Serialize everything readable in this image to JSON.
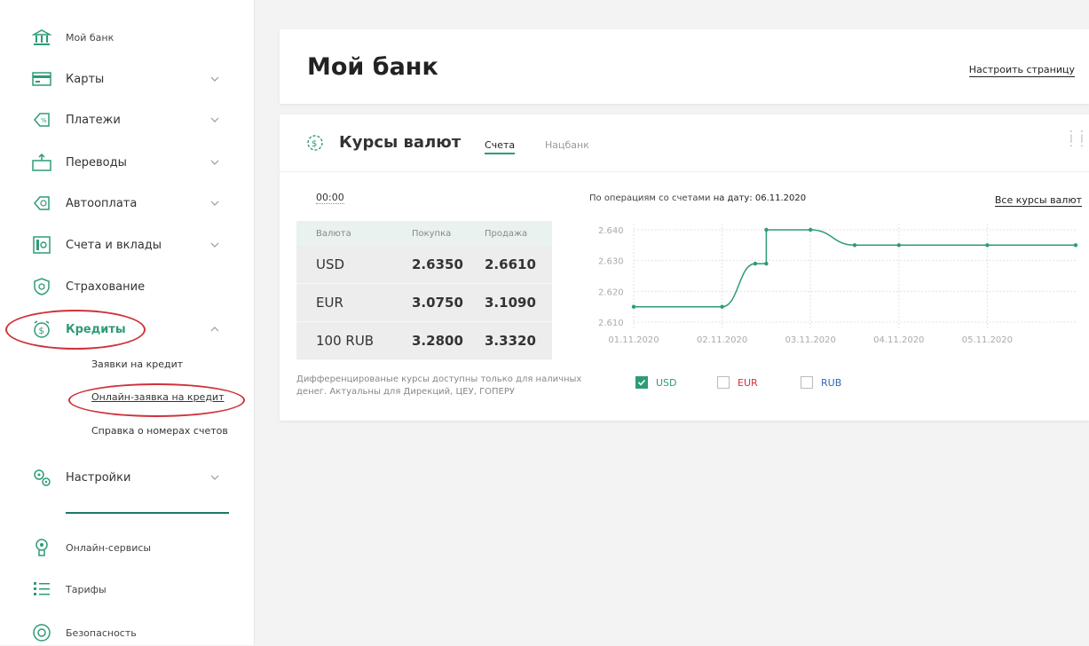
{
  "sidebar": {
    "items": [
      {
        "label": "Мой банк"
      },
      {
        "label": "Карты"
      },
      {
        "label": "Платежи"
      },
      {
        "label": "Переводы"
      },
      {
        "label": "Автооплата"
      },
      {
        "label": "Счета и вклады"
      },
      {
        "label": "Страхование"
      },
      {
        "label": "Кредиты"
      },
      {
        "label": "Настройки"
      }
    ],
    "sub_items": [
      {
        "label": "Заявки на кредит"
      },
      {
        "label": "Онлайн-заявка на кредит"
      },
      {
        "label": "Справка о номерах счетов"
      }
    ],
    "bottom_items": [
      {
        "label": "Онлайн-сервисы"
      },
      {
        "label": "Тарифы"
      },
      {
        "label": "Безопасность"
      }
    ]
  },
  "header": {
    "title": "Мой банк",
    "customize_label": "Настроить страницу"
  },
  "rates": {
    "title": "Курсы валют",
    "tabs": [
      {
        "label": "Счета"
      },
      {
        "label": "Нацбанк"
      }
    ],
    "time": "00:00",
    "table": {
      "headers": [
        "Валюта",
        "Покупка",
        "Продажа"
      ],
      "rows": [
        {
          "currency": "USD",
          "buy": "2.6350",
          "sell": "2.6610"
        },
        {
          "currency": "EUR",
          "buy": "3.0750",
          "sell": "3.1090"
        },
        {
          "currency": "100 RUB",
          "buy": "3.2800",
          "sell": "3.3320"
        }
      ]
    },
    "note": "Дифференцированые курсы доступны только для наличных денег. Актуальны для Дирекций, ЦЕУ, ГОПЕРУ",
    "ops_prefix": "По операциям со счетами",
    "ops_date": "на дату: 06.11.2020",
    "all_rates_label": "Все курсы валют",
    "legend": [
      {
        "label": "USD",
        "checked": true
      },
      {
        "label": "EUR",
        "checked": false
      },
      {
        "label": "RUB",
        "checked": false
      }
    ]
  },
  "colors": {
    "accent": "#2e9b78",
    "highlight": "#d0323a",
    "eur": "#d0323a",
    "rub": "#2f6ab0"
  },
  "chart_data": {
    "type": "line",
    "x_ticks": [
      "01.11.2020",
      "02.11.2020",
      "03.11.2020",
      "04.11.2020",
      "05.11.2020"
    ],
    "y_ticks": [
      "2.610",
      "2.620",
      "2.630",
      "2.640"
    ],
    "ylim": [
      2.608,
      2.642
    ],
    "series": [
      {
        "name": "USD",
        "points": [
          {
            "x": "01.11.2020",
            "y": 2.615
          },
          {
            "x": "02.11.2020",
            "y": 2.615
          },
          {
            "x": "02.11.2020 09:00",
            "y": 2.629
          },
          {
            "x": "02.11.2020 12:00",
            "y": 2.629
          },
          {
            "x": "02.11.2020 12:00",
            "y": 2.64
          },
          {
            "x": "03.11.2020",
            "y": 2.64
          },
          {
            "x": "03.11.2020 12:00",
            "y": 2.635
          },
          {
            "x": "04.11.2020",
            "y": 2.635
          },
          {
            "x": "05.11.2020",
            "y": 2.635
          },
          {
            "x": "06.11.2020",
            "y": 2.635
          }
        ]
      }
    ]
  }
}
